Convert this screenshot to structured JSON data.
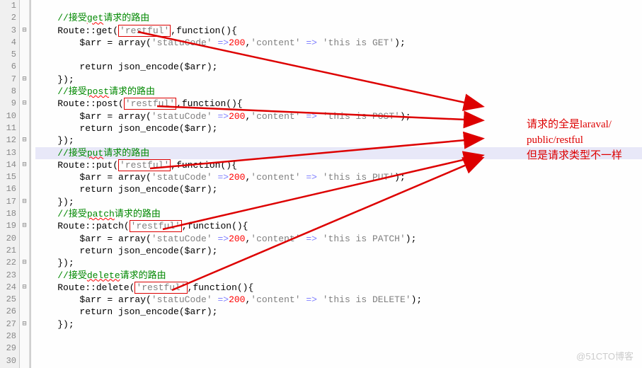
{
  "gutter": {
    "start": 1,
    "end": 30
  },
  "fold_marks": {
    "3": "⊟",
    "7": "⊟",
    "9": "⊟",
    "12": "⊟",
    "14": "⊟",
    "17": "⊟",
    "19": "⊟",
    "22": "⊟",
    "24": "⊟",
    "27": "⊟"
  },
  "highlighted_line": 13,
  "code": {
    "l1": "",
    "l2_comment": "//接受get请求的路由",
    "l2_wavy": "get",
    "l3_route": "Route::get(",
    "l3_restful": "'restful'",
    "l3_after": ",function(){",
    "l4_a": "$arr = array(",
    "l4_key1": "'statuCode'",
    "l4_arrow": " =>",
    "l4_num": "200",
    "l4_comma": ",",
    "l4_key2": "'content'",
    "l4_arrow2": " => ",
    "l4_val": "'this is GET'",
    "l4_end": ");",
    "l6": "return json_encode($arr);",
    "l7": "});",
    "l8_comment": "//接受post请求的路由",
    "l8_wavy": "post",
    "l9_route": "Route::post(",
    "l9_restful": "'restful'",
    "l9_after": ",function(){",
    "l10_val": "'this is POST'",
    "l11": "return json_encode($arr);",
    "l12": "});",
    "l13_comment": "//接受put请求的路由",
    "l13_wavy": "put",
    "l14_route": "Route::put(",
    "l14_restful": "'restful'",
    "l14_after": ",function(){",
    "l15_val": "'this is PUT'",
    "l16": "return json_encode($arr);",
    "l17": "});",
    "l18_comment": "//接受patch请求的路由",
    "l18_wavy": "patch",
    "l19_route": "Route::patch(",
    "l19_restful": "'restful'",
    "l19_after": ",function(){",
    "l20_val": "'this is PATCH'",
    "l21": "return json_encode($arr);",
    "l22": "});",
    "l23_comment": "//接受delete请求的路由",
    "l23_wavy": "delete",
    "l24_route": "Route::delete(",
    "l24_restful": "'restful'",
    "l24_after": ",function(){",
    "l25_val": "'this is DELETE'",
    "l26": "return json_encode($arr);",
    "l27": "});",
    "indent1": "    ",
    "indent2": "        "
  },
  "annotation": {
    "line1": "请求的全是laraval/",
    "line2": "public/restful",
    "line3": "但是请求类型不一样"
  },
  "watermark": "@51CTO博客"
}
